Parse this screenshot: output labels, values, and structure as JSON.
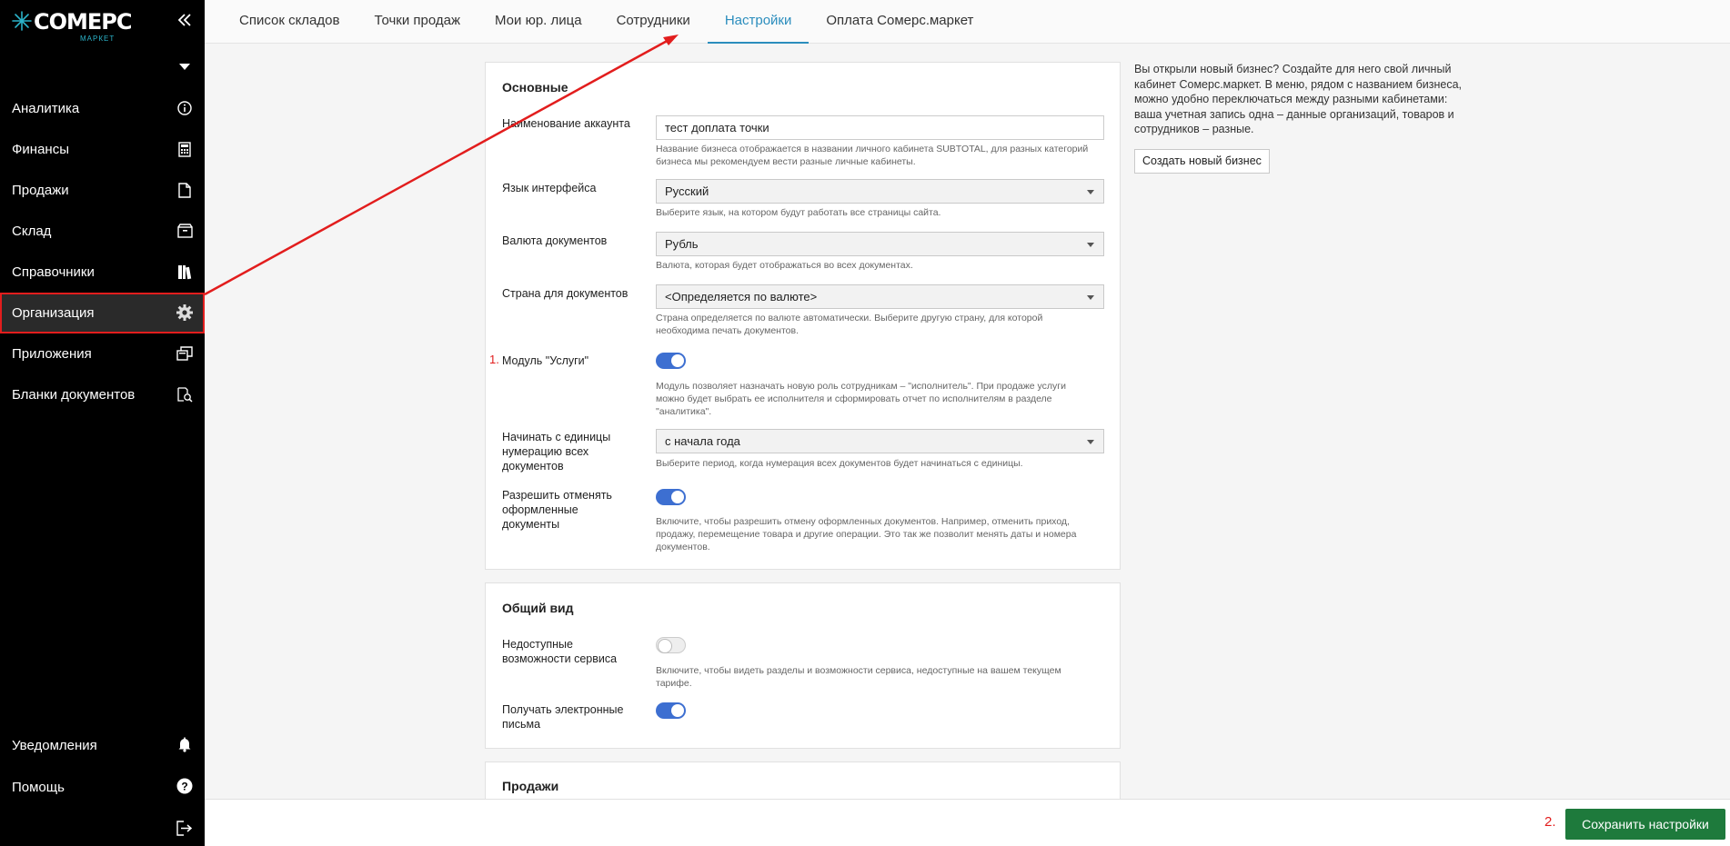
{
  "brand": {
    "name": "СОМЕРС",
    "sub": "МАРКЕТ",
    "accent": "#2bb3c9"
  },
  "sidebar": {
    "items": [
      {
        "label": "Аналитика",
        "icon": "info-icon"
      },
      {
        "label": "Финансы",
        "icon": "calculator-icon"
      },
      {
        "label": "Продажи",
        "icon": "document-icon"
      },
      {
        "label": "Склад",
        "icon": "box-icon"
      },
      {
        "label": "Справочники",
        "icon": "books-icon"
      },
      {
        "label": "Организация",
        "icon": "gear-icon",
        "active": true
      },
      {
        "label": "Приложения",
        "icon": "windows-icon"
      },
      {
        "label": "Бланки документов",
        "icon": "doc-search-icon"
      }
    ],
    "bottom": [
      {
        "label": "Уведомления",
        "icon": "bell-icon"
      },
      {
        "label": "Помощь",
        "icon": "help-icon"
      }
    ]
  },
  "tabs": [
    {
      "label": "Список складов"
    },
    {
      "label": "Точки продаж"
    },
    {
      "label": "Мои юр. лица"
    },
    {
      "label": "Сотрудники"
    },
    {
      "label": "Настройки",
      "active": true
    },
    {
      "label": "Оплата Сомерс.маркет"
    }
  ],
  "basic": {
    "title": "Основные",
    "account_label": "Наименование аккаунта",
    "account_value": "тест доплата точки",
    "account_hint": "Название бизнеса отображается в названии личного кабинета SUBTOTAL, для разных категорий бизнеса мы рекомендуем вести разные личные кабинеты.",
    "lang_label": "Язык интерфейса",
    "lang_value": "Русский",
    "lang_hint": "Выберите язык, на котором будут работать все страницы сайта.",
    "currency_label": "Валюта документов",
    "currency_value": "Рубль",
    "currency_hint": "Валюта, которая будет отображаться во всех документах.",
    "country_label": "Страна для документов",
    "country_value": "<Определяется по валюте>",
    "country_hint": "Страна определяется по валюте автоматически. Выберите другую страну, для которой необходима печать документов.",
    "services_marker": "1.",
    "services_label": "Модуль \"Услуги\"",
    "services_on": true,
    "services_hint": "Модуль позволяет назначать новую роль сотрудникам – \"исполнитель\". При продаже услуги можно будет выбрать ее исполнителя и сформировать отчет по исполнителям в разделе \"аналитика\".",
    "numbering_label": "Начинать с единицы нумерацию всех документов",
    "numbering_value": "с начала года",
    "numbering_hint": "Выберите период, когда нумерация всех документов будет начинаться с единицы.",
    "cancel_label": "Разрешить отменять оформленные документы",
    "cancel_on": true,
    "cancel_hint": "Включите, чтобы разрешить отмену оформленных документов. Например, отменить приход, продажу, перемещение товара и другие операции. Это так же позволит менять даты и номера документов."
  },
  "view": {
    "title": "Общий вид",
    "unavailable_label": "Недоступные возможности сервиса",
    "unavailable_on": false,
    "unavailable_hint": "Включите, чтобы видеть разделы и возможности сервиса, недоступные на вашем текущем тарифе.",
    "emails_label": "Получать электронные письма",
    "emails_on": true
  },
  "sales": {
    "title": "Продажи"
  },
  "info": {
    "text": "Вы открыли новый бизнес? Создайте для него свой личный кабинет Сомерс.маркет. В меню, рядом с названием бизнеса, можно удобно переключаться между разными кабинетами: ваша учетная запись одна – данные организаций, товаров и сотрудников – разные.",
    "button": "Создать новый бизнес"
  },
  "footer": {
    "marker": "2.",
    "save": "Сохранить настройки"
  }
}
